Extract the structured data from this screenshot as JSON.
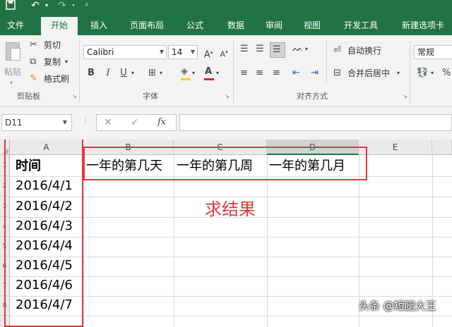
{
  "accent": "#217346",
  "highlight_color": "#e0383e",
  "quick_access": {
    "save_icon": "save-icon",
    "undo_icon": "undo-icon",
    "redo_icon": "redo-icon",
    "customize_icon": "customize-icon"
  },
  "tabs": [
    {
      "label": "文件",
      "active": false
    },
    {
      "label": "开始",
      "active": true
    },
    {
      "label": "插入",
      "active": false
    },
    {
      "label": "页面布局",
      "active": false
    },
    {
      "label": "公式",
      "active": false
    },
    {
      "label": "数据",
      "active": false
    },
    {
      "label": "审阅",
      "active": false
    },
    {
      "label": "视图",
      "active": false
    },
    {
      "label": "开发工具",
      "active": false
    },
    {
      "label": "新建选项卡",
      "active": false
    }
  ],
  "clipboard": {
    "cut": "剪切",
    "copy": "复制",
    "format_painter": "格式刷",
    "paste": "粘贴",
    "group_label": "剪贴板"
  },
  "font": {
    "name": "Calibri",
    "size": "14",
    "bold": "B",
    "italic": "I",
    "underline": "U",
    "group_label": "字体"
  },
  "alignment": {
    "wrap_text": "自动换行",
    "merge_center": "合并后居中",
    "group_label": "对齐方式"
  },
  "number": {
    "format": "常规"
  },
  "formula_bar": {
    "name_box": "D11",
    "fx": "fx"
  },
  "columns": [
    "A",
    "B",
    "C",
    "D",
    "E"
  ],
  "selected_column": "D",
  "row_numbers": [
    "1",
    "2",
    "3",
    "4",
    "5",
    "6",
    "7",
    "8"
  ],
  "cells": {
    "header": "时间",
    "dates": [
      "2016/4/1",
      "2016/4/2",
      "2016/4/3",
      "2016/4/4",
      "2016/4/5",
      "2016/4/6",
      "2016/4/7"
    ],
    "b1": "一年的第几天",
    "c1": "一年的第几周",
    "d1": "一年的第几月"
  },
  "annotation": "求结果",
  "watermark": "头条 @短腿大王"
}
